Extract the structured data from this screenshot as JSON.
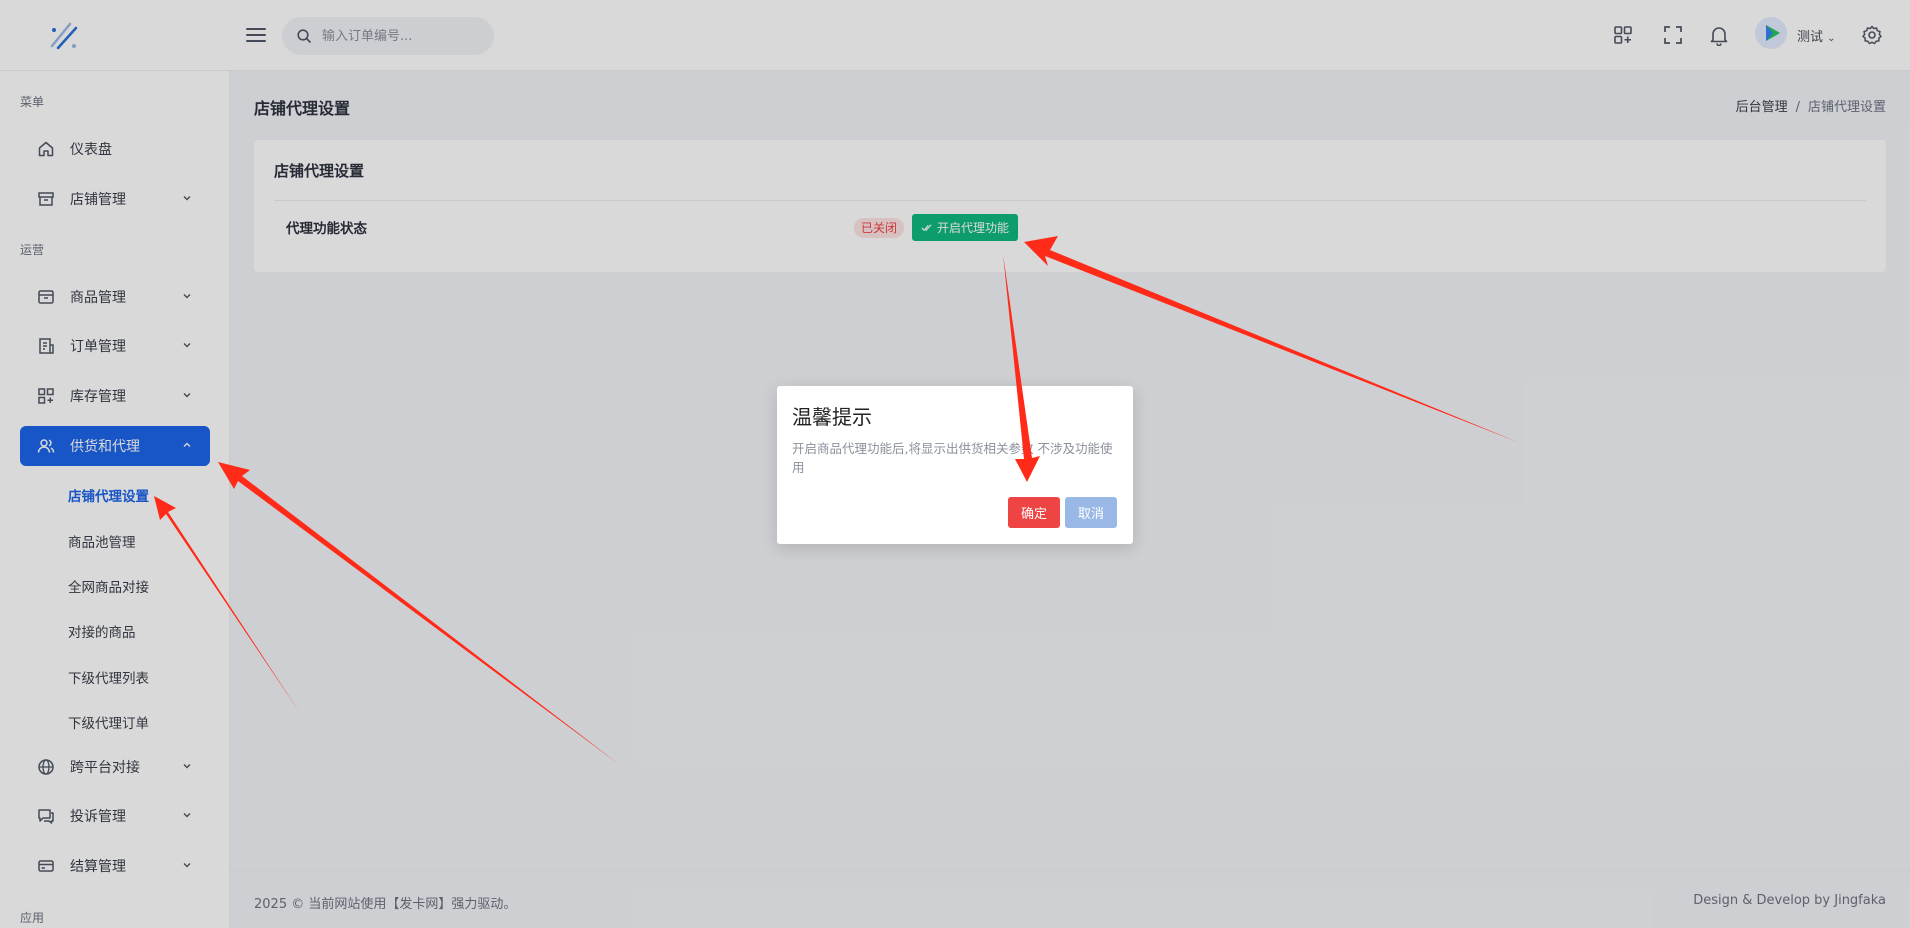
{
  "header": {
    "search_placeholder": "输入订单编号...",
    "username": "测试"
  },
  "sidebar": {
    "section_menu": "菜单",
    "section_ops": "运营",
    "section_apps": "应用",
    "items": [
      {
        "label": "仪表盘"
      },
      {
        "label": "店铺管理"
      },
      {
        "label": "商品管理"
      },
      {
        "label": "订单管理"
      },
      {
        "label": "库存管理"
      },
      {
        "label": "供货和代理"
      },
      {
        "label": "跨平台对接"
      },
      {
        "label": "投诉管理"
      },
      {
        "label": "结算管理"
      }
    ],
    "subitems": [
      {
        "label": "店铺代理设置"
      },
      {
        "label": "商品池管理"
      },
      {
        "label": "全网商品对接"
      },
      {
        "label": "对接的商品"
      },
      {
        "label": "下级代理列表"
      },
      {
        "label": "下级代理订单"
      }
    ]
  },
  "main": {
    "page_title": "店铺代理设置",
    "breadcrumb": {
      "home": "后台管理",
      "separator": "/",
      "current": "店铺代理设置"
    },
    "card": {
      "title": "店铺代理设置",
      "row_label": "代理功能状态",
      "status_badge": "已关闭",
      "open_button": "开启代理功能"
    }
  },
  "modal": {
    "title": "温馨提示",
    "message": "开启商品代理功能后,将显示出供货相关参数 不涉及功能使用",
    "confirm": "确定",
    "cancel": "取消"
  },
  "footer": {
    "left": "2025 © 当前网站使用【发卡网】强力驱动。",
    "right": "Design & Develop by Jingfaka"
  },
  "colors": {
    "accent": "#1d64e9",
    "success": "#10b981",
    "danger": "#ef4444",
    "cancel": "#9ab8e6",
    "annotation_arrow": "#ff2a17"
  },
  "icons": {
    "logo": "logo-icon",
    "menu": "hamburger-icon",
    "search": "search-icon",
    "apps": "apps-icon",
    "fullscreen": "fullscreen-icon",
    "notification": "bell-icon",
    "settings": "gear-icon"
  }
}
